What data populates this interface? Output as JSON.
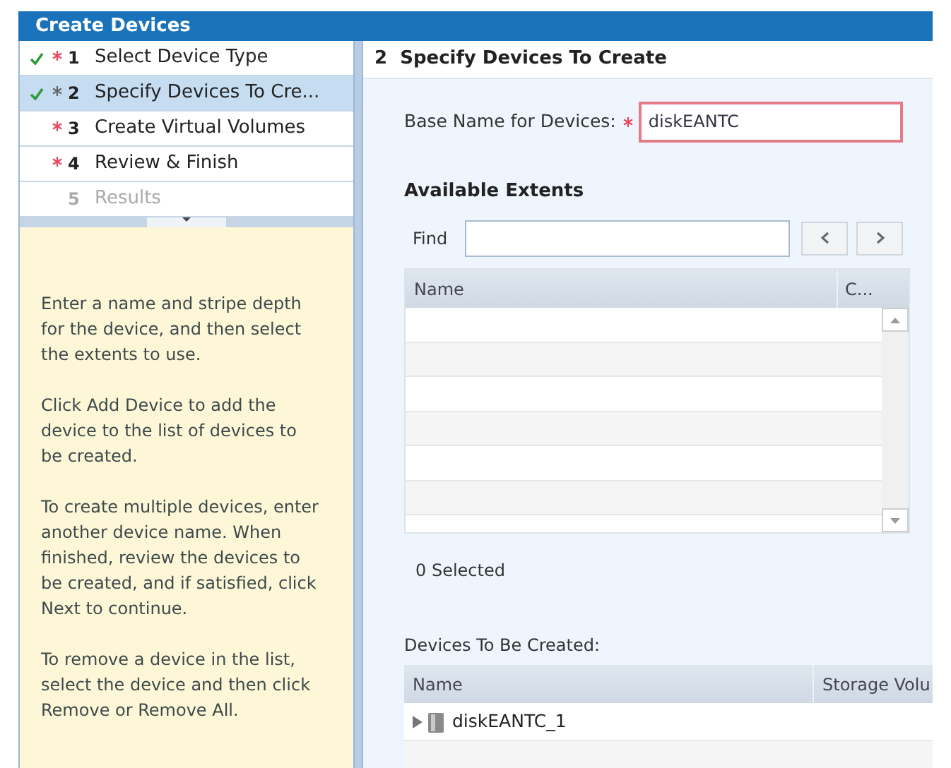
{
  "window": {
    "title": "Create Devices"
  },
  "steps": [
    {
      "number": "1",
      "label": "Select Device Type",
      "done": true,
      "required": true,
      "selected": false,
      "disabled": false
    },
    {
      "number": "2",
      "label": "Specify Devices To Cre...",
      "done": true,
      "required": true,
      "selected": true,
      "disabled": false
    },
    {
      "number": "3",
      "label": "Create Virtual Volumes",
      "done": false,
      "required": true,
      "selected": false,
      "disabled": false
    },
    {
      "number": "4",
      "label": "Review & Finish",
      "done": false,
      "required": true,
      "selected": false,
      "disabled": false
    },
    {
      "number": "5",
      "label": "Results",
      "done": false,
      "required": false,
      "selected": false,
      "disabled": true
    }
  ],
  "help": [
    "Enter a name and stripe depth for the device, and then select the extents to use.",
    "Click Add Device to add the device to the list of devices to be created.",
    "To create multiple devices, enter another device name. When finished, review the devices to be created, and if satisfied, click Next to continue.",
    "To remove a device in the list, select the device and then click Remove or Remove All."
  ],
  "content": {
    "heading": "2  Specify Devices To Create",
    "base_name": {
      "label": "Base Name for Devices:",
      "required": true,
      "value": "diskEANTC",
      "invalid": true
    },
    "extents": {
      "title": "Available Extents",
      "find_label": "Find",
      "columns": [
        "Name",
        "C..."
      ],
      "selected_count": "0 Selected"
    },
    "devices": {
      "title": "Devices To Be Created:",
      "columns": [
        "Name",
        "Storage Volu"
      ],
      "rows": [
        {
          "name": "diskEANTC_1",
          "expanded": false
        }
      ]
    }
  }
}
